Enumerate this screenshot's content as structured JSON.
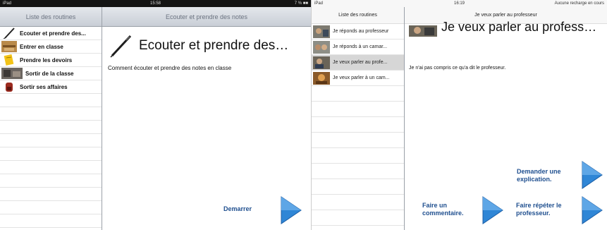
{
  "screen1": {
    "status": {
      "left": "iPad",
      "time": "15:58",
      "right": "7 % ■■"
    },
    "sidebar_title": "Liste des routines",
    "items": [
      {
        "label": "Ecouter et prendre des...",
        "icon": "pen-icon"
      },
      {
        "label": "Entrer en classe",
        "icon": "classroom-thumbnail"
      },
      {
        "label": "Prendre les devoirs",
        "icon": "notebook-icon"
      },
      {
        "label": "Sortir de la classe",
        "icon": "classroom-thumbnail"
      },
      {
        "label": "Sortir ses affaires",
        "icon": "backpack-icon"
      }
    ],
    "detail_title": "Ecouter et prendre des notes",
    "big_title": "Ecouter et prendre des…",
    "description": "Comment écouter et prendre des notes en classe",
    "start_label": "Demarrer"
  },
  "screen2": {
    "status": {
      "left": "iPad",
      "time": "16:19",
      "right": "Aucune recharge en cours"
    },
    "sidebar_title": "Liste des routines",
    "items": [
      {
        "label": "Je réponds au professeur"
      },
      {
        "label": "Je réponds à un camar..."
      },
      {
        "label": "Je veux parler au profe..."
      },
      {
        "label": "Je veux parler à un cam..."
      }
    ],
    "selected_index": 2,
    "detail_title": "Je veux parler au professeur",
    "big_title": "Je veux parler au profess…",
    "description": "Je n'ai pas compris ce qu'a dit le professeur.",
    "actions": {
      "explain": "Demander une explication.",
      "comment": "Faire un commentaire.",
      "repeat": "Faire répéter le professeur."
    }
  },
  "colors": {
    "arrow_blue": "#2f86d6",
    "action_text": "#1f4f8f"
  }
}
